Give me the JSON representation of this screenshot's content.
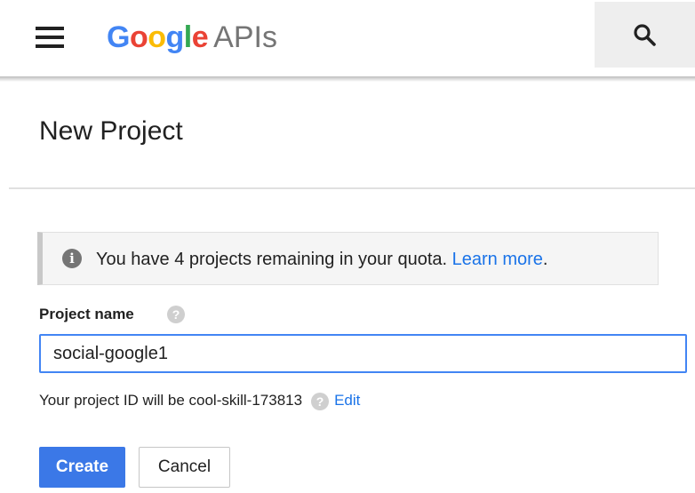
{
  "header": {
    "logo_letters": [
      "G",
      "o",
      "o",
      "g",
      "l",
      "e"
    ],
    "product_name": "APIs",
    "menu_icon": "hamburger-menu-icon",
    "search_icon": "search-icon"
  },
  "page": {
    "title": "New Project"
  },
  "quota_notice": {
    "icon": "info-icon",
    "text": "You have 4 projects remaining in your quota.",
    "link_text": "Learn more",
    "trailing": "."
  },
  "form": {
    "project_name_label": "Project name",
    "help_icon": "help-icon",
    "project_name_value": "social-google1",
    "project_id_text": "Your project ID will be cool-skill-173813",
    "edit_link": "Edit"
  },
  "actions": {
    "create_label": "Create",
    "cancel_label": "Cancel"
  },
  "colors": {
    "accent": "#4285f4",
    "link": "#1a73e8",
    "primary_button": "#3b78e7"
  }
}
